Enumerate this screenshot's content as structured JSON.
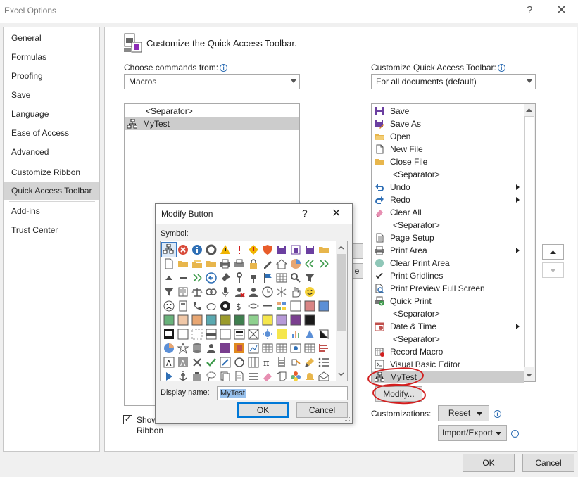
{
  "window": {
    "title": "Excel Options",
    "help": "?",
    "close": "✕"
  },
  "nav": {
    "items": [
      "General",
      "Formulas",
      "Proofing",
      "Save",
      "Language",
      "Ease of Access",
      "Advanced",
      "Customize Ribbon",
      "Quick Access Toolbar",
      "Add-ins",
      "Trust Center"
    ],
    "selected": "Quick Access Toolbar"
  },
  "main": {
    "heading": "Customize the Quick Access Toolbar.",
    "choose_label": "Choose commands from:",
    "choose_value": "Macros",
    "customize_label": "Customize Quick Access Toolbar:",
    "customize_value": "For all documents (default)",
    "commands": [
      "<Separator>",
      "MyTest"
    ],
    "toolbar_items": [
      {
        "label": "Save",
        "icon": "save-icon"
      },
      {
        "label": "Save As",
        "icon": "save-as-icon"
      },
      {
        "label": "Open",
        "icon": "folder-open-icon"
      },
      {
        "label": "New File",
        "icon": "new-file-icon"
      },
      {
        "label": "Close File",
        "icon": "folder-icon"
      },
      {
        "label": "<Separator>",
        "icon": ""
      },
      {
        "label": "Undo",
        "icon": "undo-icon",
        "submenu": true
      },
      {
        "label": "Redo",
        "icon": "redo-icon",
        "submenu": true
      },
      {
        "label": "Clear All",
        "icon": "eraser-icon"
      },
      {
        "label": "<Separator>",
        "icon": ""
      },
      {
        "label": "Page Setup",
        "icon": "page-setup-icon"
      },
      {
        "label": "Print Area",
        "icon": "print-area-icon",
        "submenu": true
      },
      {
        "label": "Clear Print Area",
        "icon": "clear-print-area-icon"
      },
      {
        "label": "Print Gridlines",
        "icon": "check-icon"
      },
      {
        "label": "Print Preview Full Screen",
        "icon": "print-preview-icon"
      },
      {
        "label": "Quick Print",
        "icon": "quick-print-icon"
      },
      {
        "label": "<Separator>",
        "icon": ""
      },
      {
        "label": "Date & Time",
        "icon": "calendar-icon",
        "submenu": true
      },
      {
        "label": "<Separator>",
        "icon": ""
      },
      {
        "label": "Record Macro",
        "icon": "record-macro-icon"
      },
      {
        "label": "Visual Basic Editor",
        "icon": "vba-icon"
      },
      {
        "label": "MyTest",
        "icon": "macro-icon",
        "selected": true
      }
    ],
    "modify_button": "Modify...",
    "customizations_label": "Customizations:",
    "reset_button": "Reset",
    "import_export_button": "Import/Export",
    "show_below_label_1": "Show",
    "show_below_label_2": "Ribbon",
    "show_below_checked": true
  },
  "footer": {
    "ok": "OK",
    "cancel": "Cancel"
  },
  "dialog": {
    "title": "Modify Button",
    "help": "?",
    "close": "✕",
    "symbol_label": "Symbol:",
    "display_name_label": "Display name:",
    "display_name_value": "MyTest",
    "ok": "OK",
    "cancel": "Cancel"
  },
  "colors": {
    "accent": "#0078d7",
    "annotation": "#d21f1f",
    "selection": "#cccccc"
  }
}
